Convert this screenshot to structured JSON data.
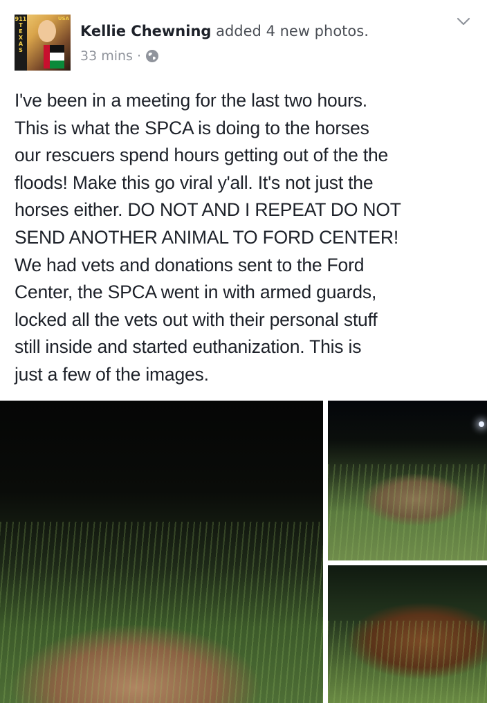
{
  "post": {
    "author": {
      "name": "Kellie Chewning",
      "action": "added 4 new photos."
    },
    "avatar": {
      "badge_text": "USA",
      "strip_letters": [
        "911",
        "T",
        "E",
        "X",
        "A",
        "S"
      ]
    },
    "timestamp": "33 mins",
    "separator": "·",
    "privacy_icon": "globe-icon",
    "menu_icon": "chevron-down-icon",
    "text_lines": [
      "I've been in a meeting for the last two hours.",
      "This is what the SPCA is doing to the horses",
      "our rescuers spend hours getting out of the the",
      "floods! Make this go viral y'all.  It's not just the",
      "horses either. DO NOT AND I REPEAT DO NOT",
      "SEND ANOTHER ANIMAL TO FORD CENTER!",
      "We had vets and donations sent to the Ford",
      "Center, the SPCA went in with armed guards,",
      "locked all the vets out with their personal stuff",
      "still inside and started euthanization. This is",
      "just a few of the images."
    ],
    "photos_count": 3
  },
  "colors": {
    "text_primary": "#1d2129",
    "text_secondary": "#4b4f56",
    "meta": "#90949c",
    "background": "#ffffff"
  }
}
